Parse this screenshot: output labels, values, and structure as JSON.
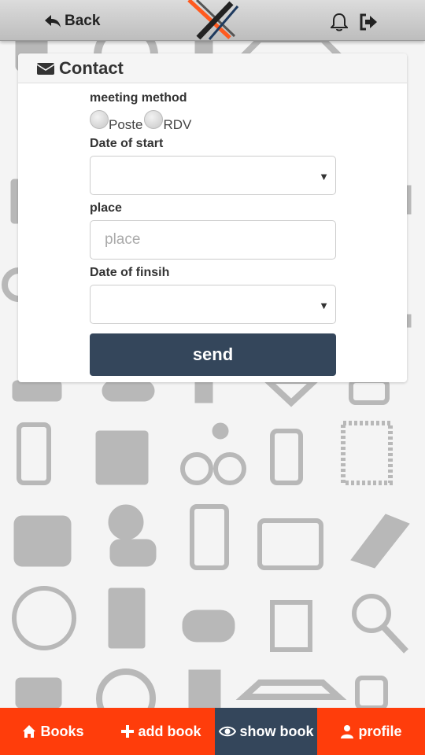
{
  "header": {
    "back_label": "Back",
    "icons": [
      "reply-icon",
      "logo",
      "bell-icon",
      "logout-icon"
    ]
  },
  "card": {
    "title": "Contact",
    "icon": "envelope-icon"
  },
  "form": {
    "meeting_label": "meeting method",
    "option_poste": "Poste",
    "option_rdv": "RDV",
    "start_label": "Date of start",
    "start_value": "",
    "place_label": "place",
    "place_placeholder": "place",
    "finish_label": "Date of finsih",
    "finish_value": "",
    "send_label": "send"
  },
  "nav": {
    "books": "Books",
    "add_book": "add book",
    "show_book": "show book",
    "profile": "profile"
  },
  "colors": {
    "accent": "#ff3d0b",
    "dark": "#34465b",
    "pattern": "#9a9a9a"
  }
}
